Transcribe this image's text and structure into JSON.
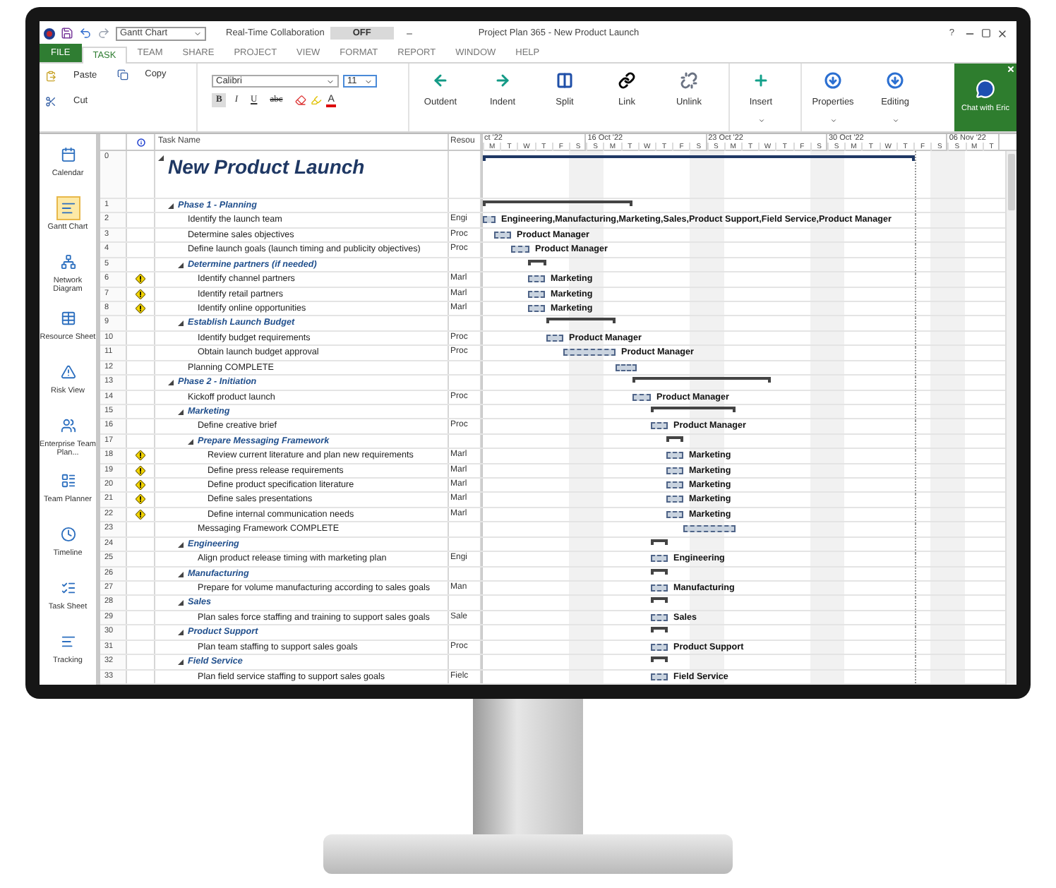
{
  "title_bar": {
    "view_select": "Gantt Chart",
    "collaboration_label": "Real-Time Collaboration",
    "collaboration_toggle": {
      "label": "OFF",
      "on": false
    },
    "title": "Project Plan 365 - New Product Launch",
    "help": "?"
  },
  "tabs": [
    {
      "label": "FILE",
      "kind": "file",
      "selected": false
    },
    {
      "label": "TASK",
      "kind": "tab",
      "selected": true
    },
    {
      "label": "TEAM",
      "kind": "tab",
      "selected": false
    },
    {
      "label": "SHARE",
      "kind": "tab",
      "selected": false
    },
    {
      "label": "PROJECT",
      "kind": "tab",
      "selected": false
    },
    {
      "label": "VIEW",
      "kind": "tab",
      "selected": false
    },
    {
      "label": "FORMAT",
      "kind": "tab",
      "selected": false
    },
    {
      "label": "REPORT",
      "kind": "tab",
      "selected": false
    },
    {
      "label": "WINDOW",
      "kind": "tab",
      "selected": false
    },
    {
      "label": "HELP",
      "kind": "tab",
      "selected": false
    }
  ],
  "ribbon": {
    "paste": "Paste",
    "copy": "Copy",
    "cut": "Cut",
    "font": {
      "family": "Calibri",
      "size": "11",
      "styles": [
        {
          "label": "B",
          "kind": "bold",
          "selected": true
        },
        {
          "label": "I",
          "kind": "italic",
          "selected": false
        },
        {
          "label": "U",
          "kind": "underline",
          "selected": false
        },
        {
          "label": "abc",
          "kind": "strike",
          "selected": false
        }
      ],
      "font_color": "A"
    },
    "commands": [
      {
        "label": "Outdent",
        "kind": "outdent",
        "dropdown": false
      },
      {
        "label": "Indent",
        "kind": "indent",
        "dropdown": false
      },
      {
        "label": "Split",
        "kind": "split",
        "dropdown": false
      },
      {
        "label": "Link",
        "kind": "link",
        "dropdown": false
      },
      {
        "label": "Unlink",
        "kind": "unlink",
        "dropdown": false
      },
      {
        "label": "Insert",
        "kind": "insert",
        "dropdown": true
      },
      {
        "label": "Properties",
        "kind": "group",
        "dropdown": true
      },
      {
        "label": "Editing",
        "kind": "group",
        "dropdown": true
      }
    ],
    "chat": {
      "label": "Chat with Eric"
    }
  },
  "views": [
    {
      "label": "Calendar",
      "kind": "calendar",
      "selected": false
    },
    {
      "label": "Gantt Chart",
      "kind": "gantt",
      "selected": true
    },
    {
      "label": "Network Diagram",
      "kind": "network",
      "selected": false
    },
    {
      "label": "Resource Sheet",
      "kind": "sheet",
      "selected": false
    },
    {
      "label": "Risk View",
      "kind": "risk",
      "selected": false
    },
    {
      "label": "Enterprise Team Plan...",
      "kind": "team",
      "selected": false
    },
    {
      "label": "Team Planner",
      "kind": "planner",
      "selected": false
    },
    {
      "label": "Timeline",
      "kind": "timeline",
      "selected": false
    },
    {
      "label": "Task Sheet",
      "kind": "tasksheet",
      "selected": false
    },
    {
      "label": "Tracking",
      "kind": "gantt",
      "selected": false
    }
  ],
  "table": {
    "columns": [
      "Task Name",
      "Resou"
    ]
  },
  "timeline": {
    "weeks": [
      {
        "label": "ct '22",
        "days": [
          "M",
          "T",
          "W",
          "T",
          "F",
          "S"
        ]
      },
      {
        "label": "16 Oct '22",
        "days": [
          "S",
          "M",
          "T",
          "W",
          "T",
          "F",
          "S"
        ]
      },
      {
        "label": "23 Oct '22",
        "days": [
          "S",
          "M",
          "T",
          "W",
          "T",
          "F",
          "S"
        ]
      },
      {
        "label": "30 Oct '22",
        "days": [
          "S",
          "M",
          "T",
          "W",
          "T",
          "F",
          "S"
        ]
      },
      {
        "label": "06 Nov '22",
        "days": [
          "S",
          "M",
          "T"
        ]
      }
    ]
  },
  "tasks": [
    {
      "id": "0",
      "name": "New Product Launch",
      "warning": false,
      "expanded": true,
      "children": [
        {
          "id": "1",
          "name": "Phase 1 - Planning",
          "warning": false,
          "expanded": true,
          "children": [
            {
              "id": "2",
              "name": "Identify the launch team",
              "warning": false,
              "resource": "Engi",
              "bar_label": "Engineering,Manufacturing,Marketing,Sales,Product Support,Field Service,Product Manager"
            },
            {
              "id": "3",
              "name": "Determine sales objectives",
              "warning": false,
              "resource": "Proc",
              "bar_label": "Product Manager"
            },
            {
              "id": "4",
              "name": "Define launch goals (launch timing and publicity objectives)",
              "warning": false,
              "resource": "Proc",
              "bar_label": "Product Manager"
            },
            {
              "id": "5",
              "name": "Determine partners (if needed)",
              "warning": false,
              "expanded": true,
              "children": [
                {
                  "id": "6",
                  "name": "Identify channel partners",
                  "warning": true,
                  "resource": "Marl",
                  "bar_label": "Marketing"
                },
                {
                  "id": "7",
                  "name": "Identify retail partners",
                  "warning": true,
                  "resource": "Marl",
                  "bar_label": "Marketing"
                },
                {
                  "id": "8",
                  "name": "Identify online opportunities",
                  "warning": true,
                  "resource": "Marl",
                  "bar_label": "Marketing"
                }
              ]
            },
            {
              "id": "9",
              "name": "Establish Launch Budget",
              "warning": false,
              "expanded": true,
              "children": [
                {
                  "id": "10",
                  "name": "Identify budget requirements",
                  "warning": false,
                  "resource": "Proc",
                  "bar_label": "Product Manager"
                },
                {
                  "id": "11",
                  "name": "Obtain launch budget approval",
                  "warning": false,
                  "resource": "Proc",
                  "bar_label": "Product Manager"
                }
              ]
            },
            {
              "id": "12",
              "name": "Planning COMPLETE",
              "warning": false
            }
          ]
        },
        {
          "id": "13",
          "name": "Phase 2 - Initiation",
          "warning": false,
          "expanded": true,
          "children": [
            {
              "id": "14",
              "name": "Kickoff product launch",
              "warning": false,
              "resource": "Proc",
              "bar_label": "Product Manager"
            },
            {
              "id": "15",
              "name": "Marketing",
              "warning": false,
              "expanded": true,
              "children": [
                {
                  "id": "16",
                  "name": "Define creative brief",
                  "warning": false,
                  "resource": "Proc",
                  "bar_label": "Product Manager"
                },
                {
                  "id": "17",
                  "name": "Prepare Messaging Framework",
                  "warning": false,
                  "expanded": true,
                  "children": [
                    {
                      "id": "18",
                      "name": "Review current literature and plan new requirements",
                      "warning": true,
                      "resource": "Marl",
                      "bar_label": "Marketing"
                    },
                    {
                      "id": "19",
                      "name": "Define press release requirements",
                      "warning": true,
                      "resource": "Marl",
                      "bar_label": "Marketing"
                    },
                    {
                      "id": "20",
                      "name": "Define product specification literature",
                      "warning": true,
                      "resource": "Marl",
                      "bar_label": "Marketing"
                    },
                    {
                      "id": "21",
                      "name": "Define sales presentations",
                      "warning": true,
                      "resource": "Marl",
                      "bar_label": "Marketing"
                    },
                    {
                      "id": "22",
                      "name": "Define internal communication needs",
                      "warning": true,
                      "resource": "Marl",
                      "bar_label": "Marketing"
                    }
                  ]
                },
                {
                  "id": "23",
                  "name": "Messaging Framework COMPLETE",
                  "warning": false
                }
              ]
            },
            {
              "id": "24",
              "name": "Engineering",
              "warning": false,
              "expanded": true,
              "children": [
                {
                  "id": "25",
                  "name": "Align product release timing with marketing plan",
                  "warning": false,
                  "resource": "Engi",
                  "bar_label": "Engineering"
                }
              ]
            },
            {
              "id": "26",
              "name": "Manufacturing",
              "warning": false,
              "expanded": true,
              "children": [
                {
                  "id": "27",
                  "name": "Prepare for volume manufacturing according to sales goals",
                  "warning": false,
                  "resource": "Man",
                  "bar_label": "Manufacturing"
                }
              ]
            },
            {
              "id": "28",
              "name": "Sales",
              "warning": false,
              "expanded": true,
              "children": [
                {
                  "id": "29",
                  "name": "Plan sales force staffing and training to support sales goals",
                  "warning": false,
                  "resource": "Sale",
                  "bar_label": "Sales"
                }
              ]
            },
            {
              "id": "30",
              "name": "Product Support",
              "warning": false,
              "expanded": true,
              "children": [
                {
                  "id": "31",
                  "name": "Plan team staffing to support sales goals",
                  "warning": false,
                  "resource": "Proc",
                  "bar_label": "Product Support"
                }
              ]
            },
            {
              "id": "32",
              "name": "Field Service",
              "warning": false,
              "expanded": true,
              "children": [
                {
                  "id": "33",
                  "name": "Plan field service staffing to support sales goals",
                  "warning": false,
                  "resource": "Fielc",
                  "bar_label": "Field Service"
                }
              ]
            }
          ]
        }
      ]
    }
  ]
}
